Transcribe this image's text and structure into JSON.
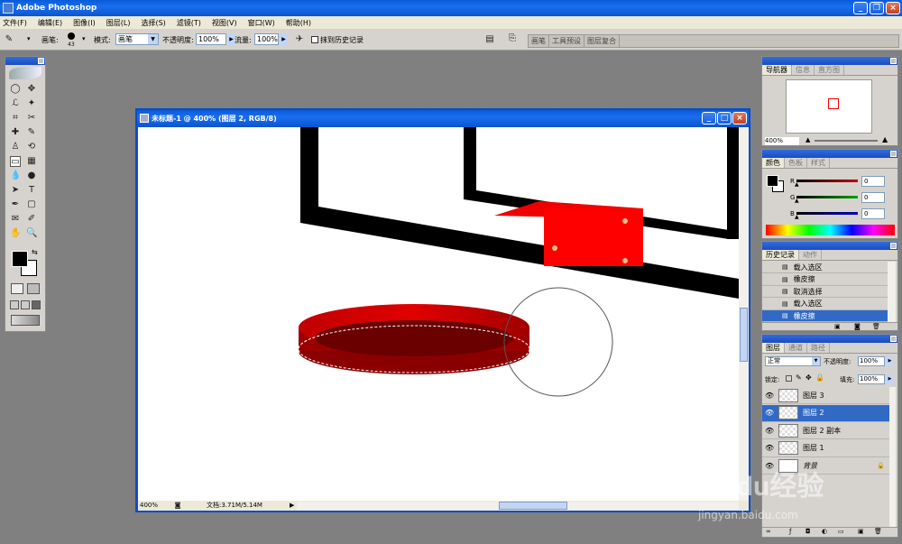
{
  "app": {
    "title": "Adobe Photoshop"
  },
  "menu": [
    "文件(F)",
    "编辑(E)",
    "图像(I)",
    "图层(L)",
    "选择(S)",
    "滤镜(T)",
    "视图(V)",
    "窗口(W)",
    "帮助(H)"
  ],
  "options": {
    "brush_label": "画笔:",
    "brush_size": "43",
    "mode_label": "模式:",
    "mode_value": "画笔",
    "opacity_label": "不透明度:",
    "opacity_value": "100%",
    "flow_label": "流量:",
    "flow_value": "100%",
    "erase_history_label": "抹到历史记录",
    "palette_tabs": [
      "画笔",
      "工具预设",
      "图层复合"
    ]
  },
  "document": {
    "title": "未标题-1 @ 400% (图层 2, RGB/8)",
    "zoom": "400%",
    "doc_info": "文档:3.71M/5.14M"
  },
  "navigator": {
    "tabs": [
      "导航器",
      "信息",
      "直方图"
    ],
    "zoom": "400%"
  },
  "color": {
    "tabs": [
      "颜色",
      "色板",
      "样式"
    ],
    "channels": [
      {
        "label": "R",
        "value": "0",
        "color": "#c00000"
      },
      {
        "label": "G",
        "value": "0",
        "color": "#00a000"
      },
      {
        "label": "B",
        "value": "0",
        "color": "#0000c0"
      }
    ]
  },
  "history": {
    "tabs": [
      "历史记录",
      "动作"
    ],
    "items": [
      "载入选区",
      "橡皮擦",
      "取消选择",
      "载入选区",
      "橡皮擦"
    ],
    "selected_index": 4
  },
  "layers": {
    "tabs": [
      "图层",
      "通道",
      "路径"
    ],
    "blend_mode": "正常",
    "opacity_label": "不透明度:",
    "opacity_value": "100%",
    "lock_label": "锁定:",
    "fill_label": "填充:",
    "fill_value": "100%",
    "items": [
      "图层 3",
      "图层 2",
      "图层 2 副本",
      "图层 1",
      "背景"
    ],
    "selected_index": 1
  },
  "watermark": {
    "brand": "Baidu经验",
    "url": "jingyan.baidu.com"
  }
}
